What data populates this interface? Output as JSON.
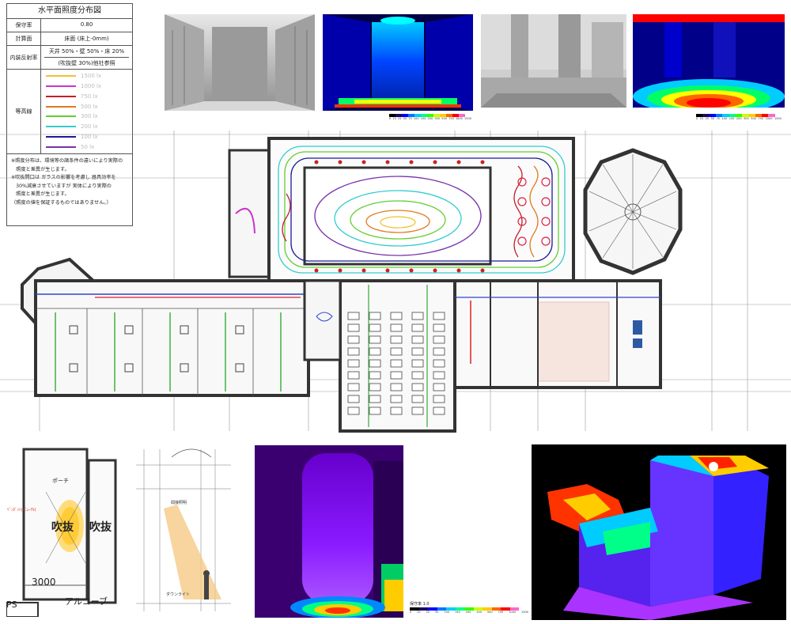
{
  "legend": {
    "title": "水平面照度分布図",
    "rows": [
      {
        "key": "保守率",
        "value": "0.80"
      },
      {
        "key": "計算面",
        "value": "床面 (床上-0mm)"
      },
      {
        "key": "内装反射率",
        "value": "天井 50%・壁 50%・床 20%",
        "extra": "(吹抜壁 30%)他社参照"
      }
    ],
    "isolines_label": "等高線",
    "isolines": [
      {
        "label": "1500 lx",
        "color": "#f2c230"
      },
      {
        "label": "1000 lx",
        "color": "#cc33cc"
      },
      {
        "label": "750 lx",
        "color": "#c21f2a"
      },
      {
        "label": "500 lx",
        "color": "#e07a1f"
      },
      {
        "label": "300 lx",
        "color": "#66cc33"
      },
      {
        "label": "200 lx",
        "color": "#33cccc"
      },
      {
        "label": "100 lx",
        "color": "#1a1a99"
      },
      {
        "label": "50 lx",
        "color": "#7733aa"
      }
    ],
    "notes": [
      "※照度分布は、環境等の諸条件の違いにより実際の",
      "　照度と差異が生じます。",
      "※吹抜開口は ガラスの影響を考慮し 器具効率を",
      "　30%減衰させていますが 実体により実際の",
      "　照度と差異が生じます。",
      "（照度の値を保証するものではありません。）"
    ]
  },
  "plan_labels": {
    "porch": "ポーチ",
    "atrium_a": "吹抜",
    "atrium_b": "吹抜",
    "dim": "3000",
    "alcove": "アルコーブ",
    "ps": "PS",
    "red_note": "ﾍﾟﾝﾀﾞﾝﾄ(ﾘﾆｭｰｱﾙ)"
  },
  "section_labels": {
    "label1": "間接照明",
    "label2": "ダウンライト"
  },
  "scale_top": {
    "ticks": [
      "0",
      "10",
      "25",
      "50",
      "75",
      "100",
      "150",
      "200",
      "300",
      "500",
      "750",
      "1000",
      "1500"
    ]
  },
  "scale_bottom": {
    "title": "保守率 1.0",
    "ticks": [
      "0",
      "10",
      "25",
      "50",
      "100",
      "150",
      "200",
      "300",
      "500",
      "750",
      "1000",
      "1500"
    ]
  },
  "colors": {
    "scale": [
      "#000000",
      "#1a0a66",
      "#0000ff",
      "#0077ff",
      "#00ccff",
      "#00ff88",
      "#33ff00",
      "#ccff00",
      "#ffcc00",
      "#ff6600",
      "#ff0000",
      "#ff66cc",
      "#ffffff"
    ]
  }
}
